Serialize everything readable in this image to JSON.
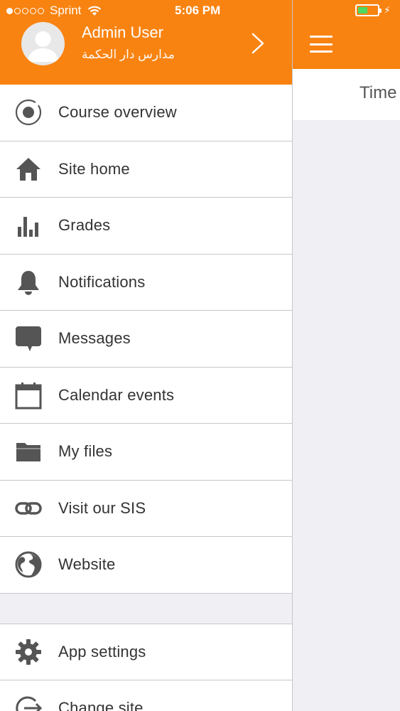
{
  "status": {
    "carrier": "Sprint",
    "time": "5:06 PM"
  },
  "user": {
    "name": "Admin User",
    "site": "مدارس دار الحكمة"
  },
  "menu": [
    {
      "label": "Course overview",
      "icon": "ionic-icon"
    },
    {
      "label": "Site home",
      "icon": "home-icon"
    },
    {
      "label": "Grades",
      "icon": "stats-bars-icon"
    },
    {
      "label": "Notifications",
      "icon": "bell-icon"
    },
    {
      "label": "Messages",
      "icon": "chat-bubble-icon"
    },
    {
      "label": "Calendar events",
      "icon": "calendar-icon"
    },
    {
      "label": "My files",
      "icon": "folder-icon"
    },
    {
      "label": "Visit our SIS",
      "icon": "link-icon"
    },
    {
      "label": "Website",
      "icon": "globe-icon"
    }
  ],
  "settings_menu": [
    {
      "label": "App settings",
      "icon": "gear-icon"
    },
    {
      "label": "Change site",
      "icon": "logout-icon"
    }
  ],
  "main": {
    "segment_label": "Time"
  },
  "colors": {
    "brand": "#f98311",
    "icon": "#555555",
    "battery": "#4cd964"
  }
}
